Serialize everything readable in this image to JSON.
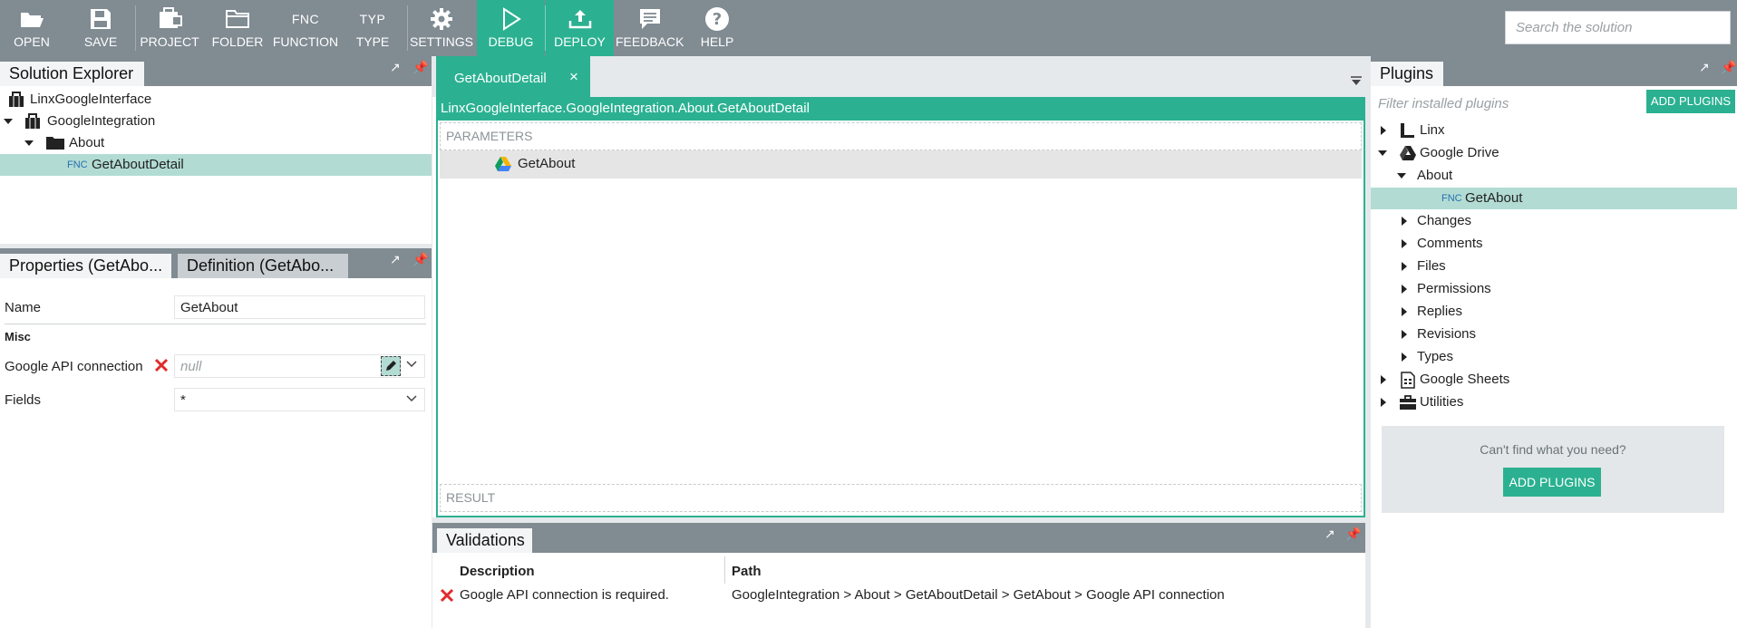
{
  "toolbar": {
    "open": "OPEN",
    "save": "SAVE",
    "project": "PROJECT",
    "folder": "FOLDER",
    "function": "FUNCTION",
    "function_icon": "FNC",
    "type": "TYPE",
    "type_icon": "TYP",
    "settings": "SETTINGS",
    "debug": "DEBUG",
    "deploy": "DEPLOY",
    "feedback": "FEEDBACK",
    "help": "HELP",
    "search_placeholder": "Search the solution",
    "accent": "#2bb191"
  },
  "solution_explorer": {
    "title": "Solution Explorer",
    "items": [
      {
        "label": "LinxGoogleInterface",
        "icon": "briefcase-icon"
      },
      {
        "label": "GoogleIntegration",
        "icon": "briefcase-icon"
      },
      {
        "label": "About",
        "icon": "folder-icon"
      },
      {
        "label": "GetAboutDetail",
        "prefix": "FNC",
        "selected": true
      }
    ]
  },
  "properties": {
    "tab_properties": "Properties (GetAbo...",
    "tab_definition": "Definition (GetAbo...",
    "name_label": "Name",
    "name_value": "GetAbout",
    "misc_label": "Misc",
    "api_label": "Google API connection",
    "api_placeholder": "null",
    "fields_label": "Fields",
    "fields_value": "*"
  },
  "editor": {
    "tab_label": "GetAboutDetail",
    "close": "×",
    "path": "LinxGoogleInterface.GoogleIntegration.About.GetAboutDetail",
    "parameters": "PARAMETERS",
    "step": "GetAbout",
    "result": "RESULT"
  },
  "validations": {
    "title": "Validations",
    "col_description": "Description",
    "col_path": "Path",
    "rows": [
      {
        "description": "Google API connection is required.",
        "path": "GoogleIntegration > About > GetAboutDetail > GetAbout > Google API connection"
      }
    ]
  },
  "plugins": {
    "title": "Plugins",
    "filter_placeholder": "Filter installed plugins",
    "add_button": "ADD PLUGINS",
    "items": [
      {
        "label": "Linx"
      },
      {
        "label": "Google Drive"
      },
      {
        "label": "About"
      },
      {
        "label": "GetAbout",
        "prefix": "FNC",
        "selected": true
      },
      {
        "label": "Changes"
      },
      {
        "label": "Comments"
      },
      {
        "label": "Files"
      },
      {
        "label": "Permissions"
      },
      {
        "label": "Replies"
      },
      {
        "label": "Revisions"
      },
      {
        "label": "Types"
      },
      {
        "label": "Google Sheets"
      },
      {
        "label": "Utilities"
      }
    ],
    "cant_find": "Can't find what you need?",
    "add_button_2": "ADD PLUGINS"
  }
}
